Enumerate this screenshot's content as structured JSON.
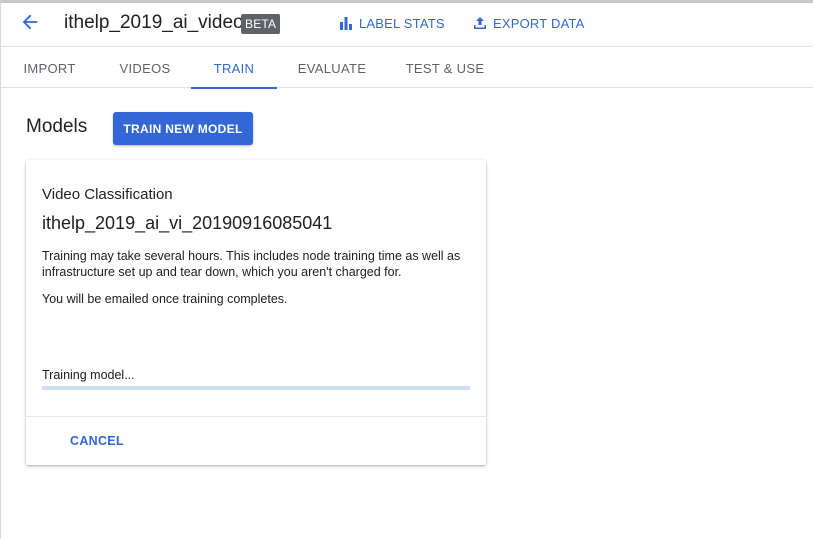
{
  "header": {
    "title": "ithelp_2019_ai_video",
    "badge": "BETA",
    "actions": {
      "label_stats": "LABEL STATS",
      "export_data": "EXPORT DATA"
    }
  },
  "tabs": {
    "import": "IMPORT",
    "videos": "VIDEOS",
    "train": "TRAIN",
    "evaluate": "EVALUATE",
    "test_use": "TEST & USE",
    "active": "TRAIN"
  },
  "models": {
    "title": "Models",
    "train_button": "TRAIN NEW MODEL"
  },
  "card": {
    "kind": "Video Classification",
    "model_name": "ithelp_2019_ai_vi_20190916085041",
    "description": "Training may take several hours. This includes node training time as well as infrastructure set up and tear down, which you aren't charged for.",
    "email_note": "You will be emailed once training completes.",
    "status": "Training model...",
    "progress_percent": 0,
    "cancel_label": "CANCEL"
  },
  "colors": {
    "accent": "#3367d6",
    "badge_bg": "#5f6368",
    "progress_track": "#cfdef0"
  },
  "icons": {
    "back": "arrow-left-icon",
    "label_stats": "bar-chart-icon",
    "export_data": "upload-icon"
  }
}
